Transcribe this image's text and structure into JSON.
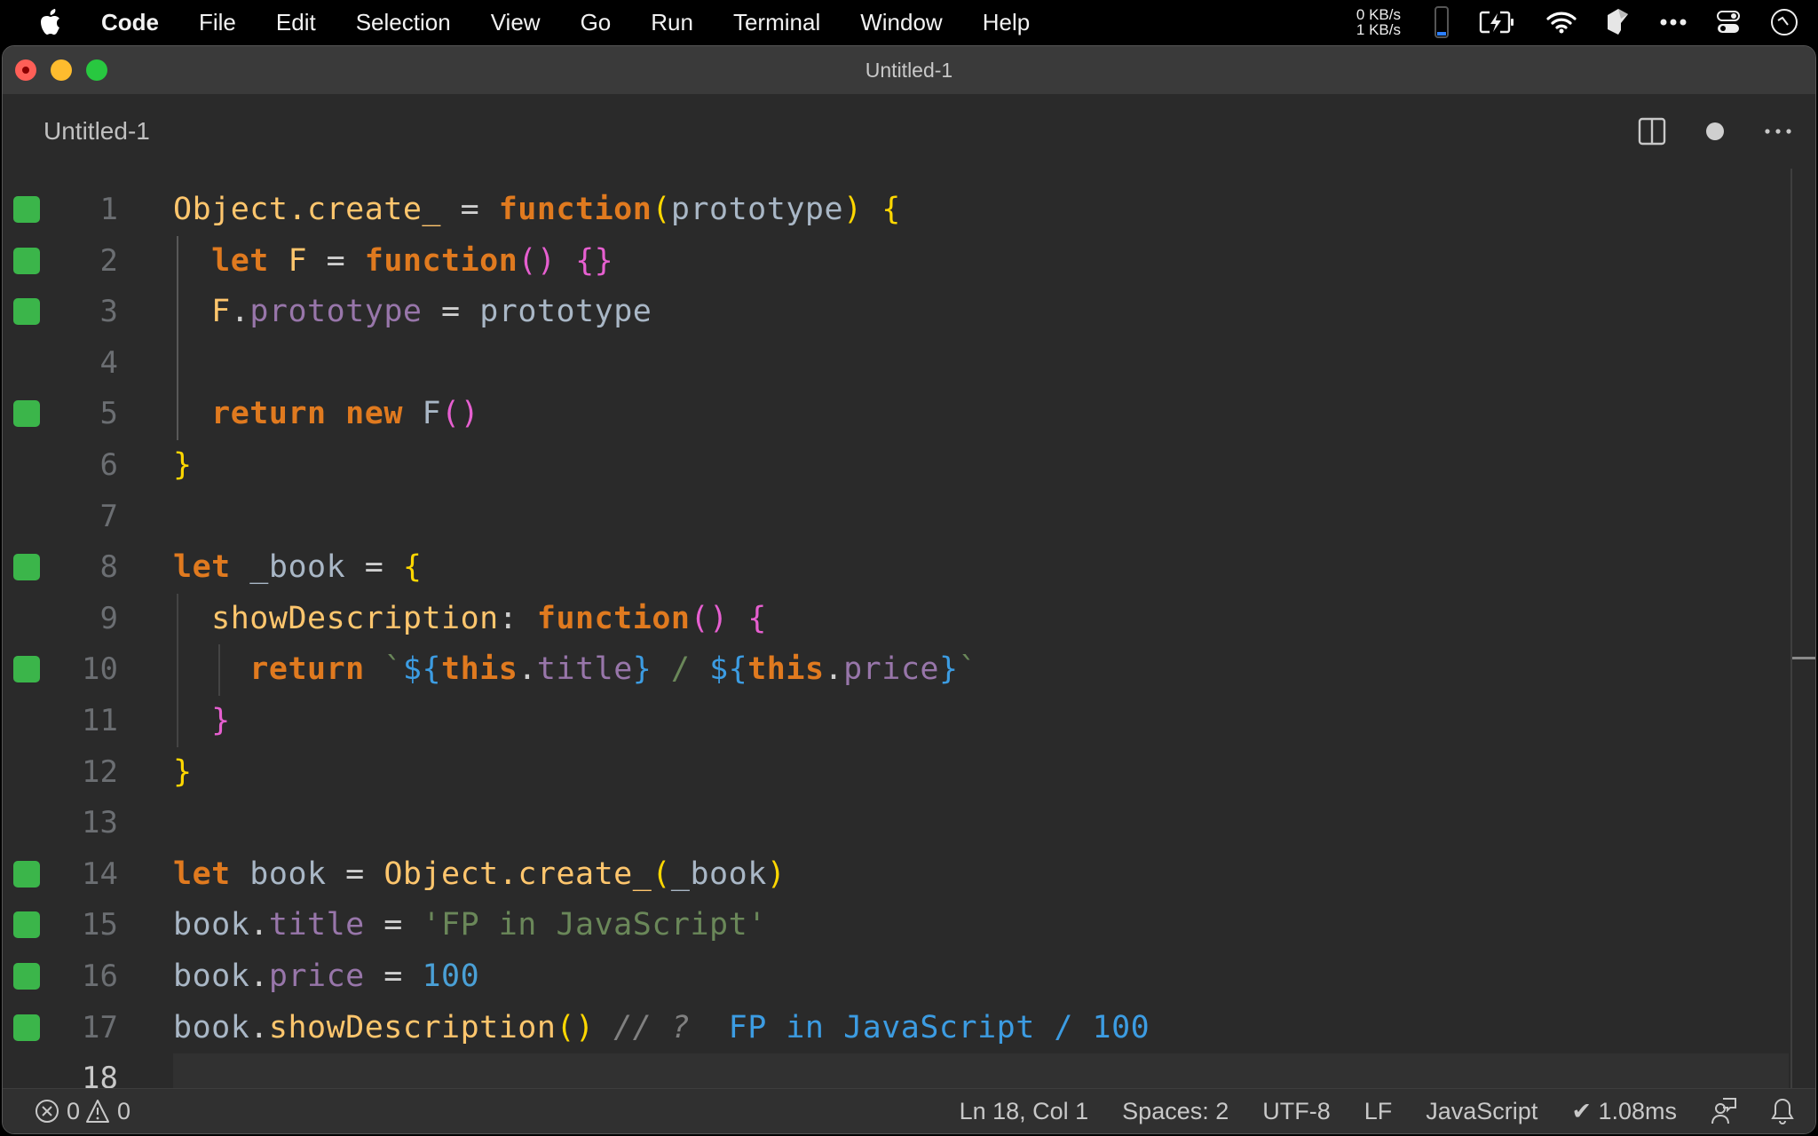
{
  "menubar": {
    "app_name": "Code",
    "items": [
      "File",
      "Edit",
      "Selection",
      "View",
      "Go",
      "Run",
      "Terminal",
      "Window",
      "Help"
    ],
    "net_up": "0 KB/s",
    "net_down": "1 KB/s",
    "tray_icons": [
      "battery-level-icon",
      "battery-charging-icon",
      "wifi-icon",
      "cube-app-icon",
      "more-icon",
      "control-center-icon",
      "clock-icon"
    ]
  },
  "window": {
    "title": "Untitled-1"
  },
  "tab": {
    "label": "Untitled-1",
    "actions": [
      "split-editor-icon",
      "unsaved-dot-icon",
      "more-actions-icon"
    ]
  },
  "editor": {
    "current_line": 18,
    "marked_lines": [
      1,
      2,
      3,
      5,
      8,
      10,
      14,
      15,
      16,
      17
    ],
    "lines": [
      {
        "n": "1",
        "tokens": [
          [
            "Object.create_",
            "t-fn"
          ],
          [
            " = ",
            "t-op"
          ],
          [
            "function",
            "t-kw"
          ],
          [
            "(",
            "b-yel"
          ],
          [
            "prototype",
            "t-var"
          ],
          [
            ")",
            "b-yel"
          ],
          [
            " ",
            "t-op"
          ],
          [
            "{",
            "b-yel"
          ]
        ]
      },
      {
        "n": "2",
        "tokens": [
          [
            "  ",
            "t-op"
          ],
          [
            "let",
            "t-kw"
          ],
          [
            " ",
            "t-op"
          ],
          [
            "F",
            "t-fn"
          ],
          [
            " = ",
            "t-op"
          ],
          [
            "function",
            "t-kw"
          ],
          [
            "()",
            "b-pink"
          ],
          [
            " ",
            "t-op"
          ],
          [
            "{}",
            "b-pink"
          ]
        ]
      },
      {
        "n": "3",
        "tokens": [
          [
            "  ",
            "t-op"
          ],
          [
            "F",
            "t-fn"
          ],
          [
            ".",
            "t-op"
          ],
          [
            "prototype",
            "t-prop"
          ],
          [
            " = ",
            "t-op"
          ],
          [
            "prototype",
            "t-var"
          ]
        ]
      },
      {
        "n": "4",
        "tokens": []
      },
      {
        "n": "5",
        "tokens": [
          [
            "  ",
            "t-op"
          ],
          [
            "return",
            "t-kw"
          ],
          [
            " ",
            "t-op"
          ],
          [
            "new",
            "t-kw"
          ],
          [
            " ",
            "t-op"
          ],
          [
            "F",
            "t-var"
          ],
          [
            "()",
            "b-pink"
          ]
        ]
      },
      {
        "n": "6",
        "tokens": [
          [
            "}",
            "b-yel"
          ]
        ]
      },
      {
        "n": "7",
        "tokens": []
      },
      {
        "n": "8",
        "tokens": [
          [
            "let",
            "t-kw"
          ],
          [
            " ",
            "t-op"
          ],
          [
            "_book",
            "t-var"
          ],
          [
            " = ",
            "t-op"
          ],
          [
            "{",
            "b-yel"
          ]
        ]
      },
      {
        "n": "9",
        "tokens": [
          [
            "  ",
            "t-op"
          ],
          [
            "showDescription",
            "t-fn"
          ],
          [
            ": ",
            "t-op"
          ],
          [
            "function",
            "t-kw"
          ],
          [
            "()",
            "b-pink"
          ],
          [
            " ",
            "t-op"
          ],
          [
            "{",
            "b-pink"
          ]
        ]
      },
      {
        "n": "10",
        "tokens": [
          [
            "    ",
            "t-op"
          ],
          [
            "return",
            "t-kw"
          ],
          [
            " ",
            "t-op"
          ],
          [
            "`",
            "t-str"
          ],
          [
            "${",
            "b-blue"
          ],
          [
            "this",
            "t-kw"
          ],
          [
            ".",
            "t-op"
          ],
          [
            "title",
            "t-prop"
          ],
          [
            "}",
            "b-blue"
          ],
          [
            " / ",
            "t-str"
          ],
          [
            "${",
            "b-blue"
          ],
          [
            "this",
            "t-kw"
          ],
          [
            ".",
            "t-op"
          ],
          [
            "price",
            "t-prop"
          ],
          [
            "}",
            "b-blue"
          ],
          [
            "`",
            "t-str"
          ]
        ]
      },
      {
        "n": "11",
        "tokens": [
          [
            "  ",
            "t-op"
          ],
          [
            "}",
            "b-pink"
          ]
        ]
      },
      {
        "n": "12",
        "tokens": [
          [
            "}",
            "b-yel"
          ]
        ]
      },
      {
        "n": "13",
        "tokens": []
      },
      {
        "n": "14",
        "tokens": [
          [
            "let",
            "t-kw"
          ],
          [
            " ",
            "t-op"
          ],
          [
            "book",
            "t-var"
          ],
          [
            " = ",
            "t-op"
          ],
          [
            "Object.create_",
            "t-fn"
          ],
          [
            "(",
            "b-yel"
          ],
          [
            "_book",
            "t-var"
          ],
          [
            ")",
            "b-yel"
          ]
        ]
      },
      {
        "n": "15",
        "tokens": [
          [
            "book",
            "t-var"
          ],
          [
            ".",
            "t-op"
          ],
          [
            "title",
            "t-prop"
          ],
          [
            " = ",
            "t-op"
          ],
          [
            "'FP in JavaScript'",
            "t-str"
          ]
        ]
      },
      {
        "n": "16",
        "tokens": [
          [
            "book",
            "t-var"
          ],
          [
            ".",
            "t-op"
          ],
          [
            "price",
            "t-prop"
          ],
          [
            " = ",
            "t-op"
          ],
          [
            "100",
            "t-num"
          ]
        ]
      },
      {
        "n": "17",
        "tokens": [
          [
            "book",
            "t-var"
          ],
          [
            ".",
            "t-op"
          ],
          [
            "showDescription",
            "t-fn"
          ],
          [
            "()",
            "b-yel"
          ],
          [
            " ",
            "t-op"
          ],
          [
            "// ?",
            "t-com"
          ],
          [
            "  ",
            "t-op"
          ],
          [
            "FP in JavaScript / 100",
            "t-res"
          ]
        ]
      },
      {
        "n": "18",
        "tokens": []
      }
    ]
  },
  "statusbar": {
    "errors": "0",
    "warnings": "0",
    "position": "Ln 18, Col 1",
    "indent": "Spaces: 2",
    "encoding": "UTF-8",
    "eol": "LF",
    "language": "JavaScript",
    "timing": "✔ 1.08ms"
  }
}
